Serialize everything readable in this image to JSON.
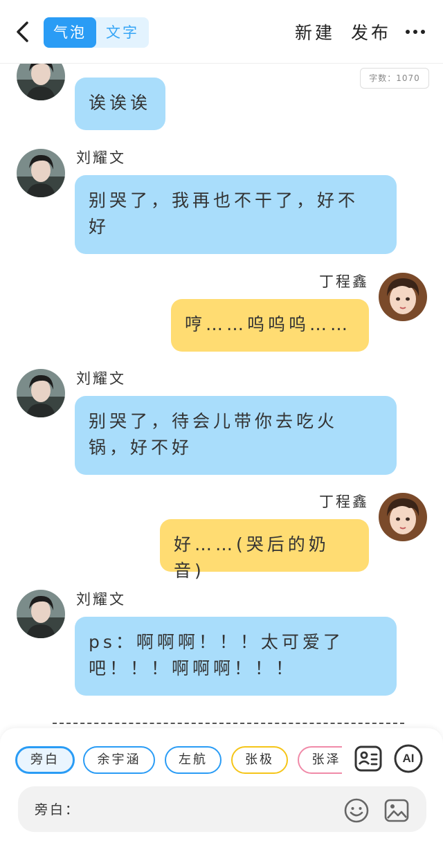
{
  "header": {
    "tabs": [
      {
        "label": "气泡",
        "active": true
      },
      {
        "label": "文字",
        "active": false
      }
    ],
    "new_label": "新建",
    "publish_label": "发布",
    "icons": {
      "back": "chevron-left-icon",
      "more": "more-horizontal-icon"
    }
  },
  "word_count": "字数：1070",
  "messages": [
    {
      "speaker": "",
      "side": "left",
      "color": "blue",
      "lines": [
        "诶诶诶"
      ]
    },
    {
      "speaker": "刘耀文",
      "side": "left",
      "color": "blue",
      "lines": [
        "别哭了，我再也不干了，好不",
        "好"
      ]
    },
    {
      "speaker": "丁程鑫",
      "side": "right",
      "color": "yellow",
      "lines": [
        "哼……呜呜呜……"
      ]
    },
    {
      "speaker": "刘耀文",
      "side": "left",
      "color": "blue",
      "lines": [
        "别哭了，待会儿带你去吃火",
        "锅，好不好"
      ]
    },
    {
      "speaker": "丁程鑫",
      "side": "right",
      "color": "yellow",
      "lines": [
        "好……(哭后的奶音)"
      ]
    },
    {
      "speaker": "刘耀文",
      "side": "left",
      "color": "blue",
      "lines": [
        "ps：啊啊啊！！！太可爱了",
        "吧！！！啊啊啊！！！"
      ]
    }
  ],
  "characters": [
    {
      "label": "旁白",
      "selected": true,
      "color": "#2a9cf5"
    },
    {
      "label": "余宇涵",
      "selected": false,
      "color": "#2a9cf5"
    },
    {
      "label": "左航",
      "selected": false,
      "color": "#2a9cf5"
    },
    {
      "label": "张极",
      "selected": false,
      "color": "#f5c518"
    },
    {
      "label": "张泽禹",
      "selected": false,
      "color": "#f08aa8"
    }
  ],
  "tools": {
    "cards_icon": "character-card-icon",
    "ai_label": "AI"
  },
  "input": {
    "label": "旁白：",
    "emoji_icon": "emoji-icon",
    "image_icon": "image-icon"
  },
  "colors": {
    "accent": "#2a9cf5",
    "bubble_blue": "#a9ddfb",
    "bubble_yellow": "#ffdc72"
  }
}
